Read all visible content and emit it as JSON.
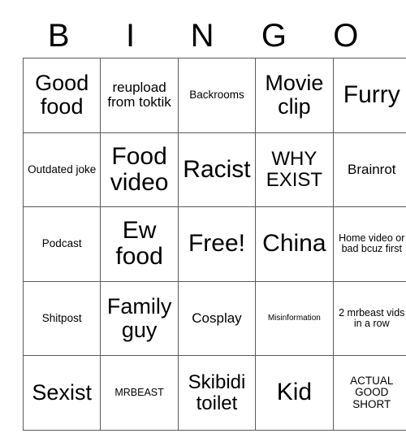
{
  "card": {
    "header_letters": [
      "B",
      "I",
      "N",
      "G",
      "O"
    ],
    "rows": [
      [
        {
          "text": "Good food",
          "size": "fs-xl"
        },
        {
          "text": "reupload from toktik",
          "size": "fs-md"
        },
        {
          "text": "Backrooms",
          "size": "fs-sm"
        },
        {
          "text": "Movie clip",
          "size": "fs-xl"
        },
        {
          "text": "Furry",
          "size": "fs-xxl"
        }
      ],
      [
        {
          "text": "Outdated joke",
          "size": "fs-sm"
        },
        {
          "text": "Food video",
          "size": "fs-xxl"
        },
        {
          "text": "Racist",
          "size": "fs-xxl"
        },
        {
          "text": "WHY EXIST",
          "size": "fs-lg"
        },
        {
          "text": "Brainrot",
          "size": "fs-md"
        }
      ],
      [
        {
          "text": "Podcast",
          "size": "fs-sm"
        },
        {
          "text": "Ew food",
          "size": "fs-xxl"
        },
        {
          "text": "Free!",
          "size": "fs-xxl"
        },
        {
          "text": "China",
          "size": "fs-xxl"
        },
        {
          "text": "Home video or bad bcuz first",
          "size": "fs-xs"
        }
      ],
      [
        {
          "text": "Shitpost",
          "size": "fs-sm"
        },
        {
          "text": "Family guy",
          "size": "fs-xl"
        },
        {
          "text": "Cosplay",
          "size": "fs-md"
        },
        {
          "text": "Misinformation",
          "size": "fs-xxs"
        },
        {
          "text": "2 mrbeast vids in a row",
          "size": "fs-xs"
        }
      ],
      [
        {
          "text": "Sexist",
          "size": "fs-xl"
        },
        {
          "text": "MRBEAST",
          "size": "fs-xs"
        },
        {
          "text": "Skibidi toilet",
          "size": "fs-lg"
        },
        {
          "text": "Kid",
          "size": "fs-xxl"
        },
        {
          "text": "ACTUAL GOOD SHORT",
          "size": "fs-sm"
        }
      ]
    ]
  }
}
